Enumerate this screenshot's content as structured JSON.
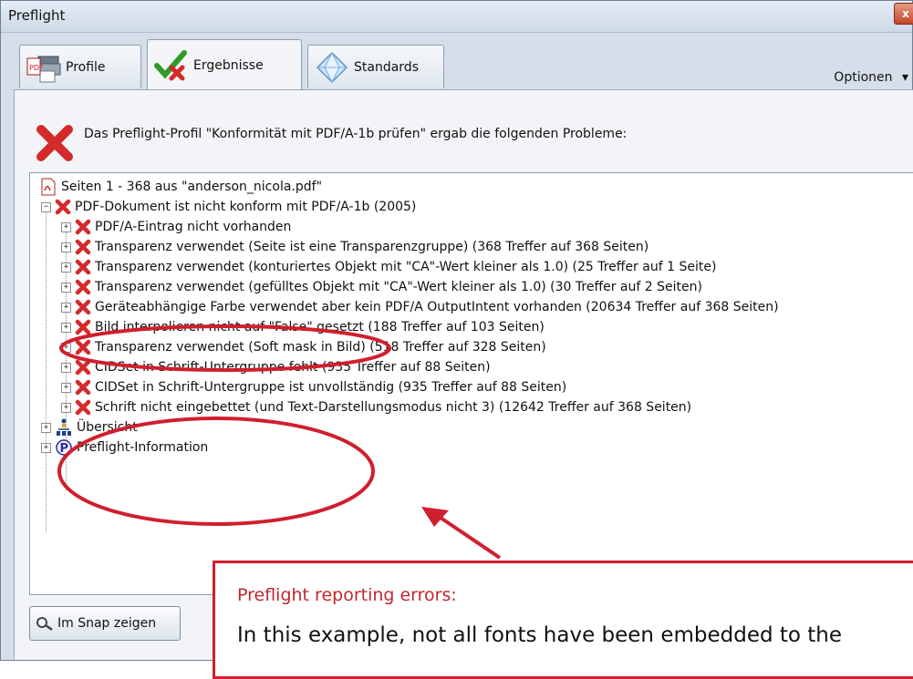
{
  "window": {
    "title": "Preflight",
    "close_label": "x"
  },
  "tabs": [
    {
      "label": "Profile",
      "icon": "profile-icon"
    },
    {
      "label": "Ergebnisse",
      "icon": "results-checkmark-icon"
    },
    {
      "label": "Standards",
      "icon": "standards-diamond-icon"
    }
  ],
  "options_label": "Optionen",
  "options_arrow": "▾",
  "header_message": "Das Preflight-Profil \"Konformität mit PDF/A-1b prüfen\" ergab die folgenden Probleme:",
  "tree": {
    "root_label": "Seiten 1 - 368 aus \"anderson_nicola.pdf\"",
    "document_label": "PDF-Dokument ist nicht konform mit PDF/A-1b (2005)",
    "issues": [
      "PDF/A-Eintrag nicht vorhanden",
      "Transparenz verwendet (Seite ist eine Transparenzgruppe) (368 Treffer auf 368 Seiten)",
      "Transparenz verwendet (konturiertes Objekt mit \"CA\"-Wert kleiner als 1.0) (25 Treffer auf 1 Seite)",
      "Transparenz verwendet (gefülltes Objekt mit \"CA\"-Wert kleiner als 1.0) (30 Treffer auf 2 Seiten)",
      "Geräteabhängige Farbe verwendet aber kein PDF/A OutputIntent vorhanden (20634 Treffer auf 368 Seiten)",
      "Bild interpolieren nicht auf \"False\" gesetzt (188 Treffer auf 103 Seiten)",
      "Transparenz verwendet (Soft mask in Bild) (518 Treffer auf 328 Seiten)",
      "CIDSet in Schrift-Untergruppe fehlt (935 Treffer auf 88 Seiten)",
      "CIDSet in Schrift-Untergruppe ist unvollständig (935 Treffer auf 88 Seiten)",
      "Schrift nicht eingebettet (und Text-Darstellungsmodus nicht 3) (12642 Treffer auf 368 Seiten)"
    ],
    "overview_label": "Übersicht",
    "info_label": "Preflight-Information"
  },
  "buttons": {
    "snap_label": "Im Snap zeigen"
  },
  "callout": {
    "title": "Preflight reporting errors:",
    "text": "In this example, not all fonts have been embedded to the"
  },
  "colors": {
    "error_red": "#d42a2a",
    "annotation_red": "#d01f2d",
    "callout_title": "#c0272d"
  }
}
